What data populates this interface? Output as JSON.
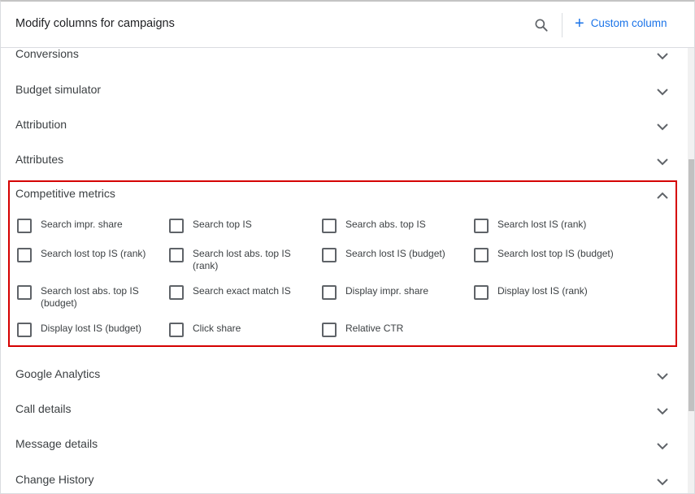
{
  "header": {
    "title": "Modify columns for campaigns",
    "search_icon": "search-icon",
    "custom_column_label": "Custom column",
    "accent": "#1a73e8"
  },
  "sections_top": [
    {
      "label": "Conversions",
      "expanded": false
    },
    {
      "label": "Budget simulator",
      "expanded": false
    },
    {
      "label": "Attribution",
      "expanded": false
    },
    {
      "label": "Attributes",
      "expanded": false
    }
  ],
  "competitive": {
    "label": "Competitive metrics",
    "expanded": true,
    "highlight_color": "#d50000",
    "options": [
      {
        "label": "Search impr. share",
        "checked": false
      },
      {
        "label": "Search top IS",
        "checked": false
      },
      {
        "label": "Search abs. top IS",
        "checked": false
      },
      {
        "label": "Search lost IS (rank)",
        "checked": false
      },
      {
        "label": "Search lost top IS (rank)",
        "checked": false
      },
      {
        "label": "Search lost abs. top IS (rank)",
        "checked": false
      },
      {
        "label": "Search lost IS (budget)",
        "checked": false
      },
      {
        "label": "Search lost top IS (budget)",
        "checked": false
      },
      {
        "label": "Search lost abs. top IS (budget)",
        "checked": false
      },
      {
        "label": "Search exact match IS",
        "checked": false
      },
      {
        "label": "Display impr. share",
        "checked": false
      },
      {
        "label": "Display lost IS (rank)",
        "checked": false
      },
      {
        "label": "Display lost IS (budget)",
        "checked": false
      },
      {
        "label": "Click share",
        "checked": false
      },
      {
        "label": "Relative CTR",
        "checked": false
      }
    ]
  },
  "sections_bottom": [
    {
      "label": "Google Analytics",
      "expanded": false
    },
    {
      "label": "Call details",
      "expanded": false
    },
    {
      "label": "Message details",
      "expanded": false
    },
    {
      "label": "Change History",
      "expanded": false
    }
  ]
}
